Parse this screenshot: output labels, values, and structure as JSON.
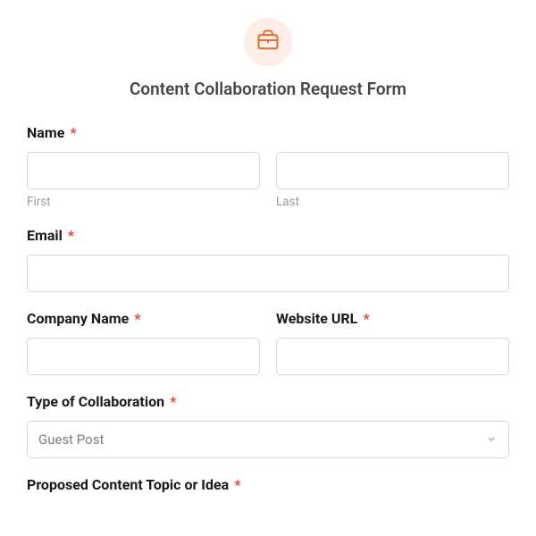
{
  "form": {
    "title": "Content Collaboration Request Form",
    "icon": "briefcase-icon"
  },
  "fields": {
    "name": {
      "label": "Name",
      "first": {
        "sublabel": "First",
        "value": ""
      },
      "last": {
        "sublabel": "Last",
        "value": ""
      }
    },
    "email": {
      "label": "Email",
      "value": ""
    },
    "company": {
      "label": "Company Name",
      "value": ""
    },
    "website": {
      "label": "Website URL",
      "value": ""
    },
    "collab_type": {
      "label": "Type of Collaboration",
      "selected": "Guest Post"
    },
    "topic": {
      "label": "Proposed Content Topic or Idea"
    }
  },
  "required_marker": "*"
}
